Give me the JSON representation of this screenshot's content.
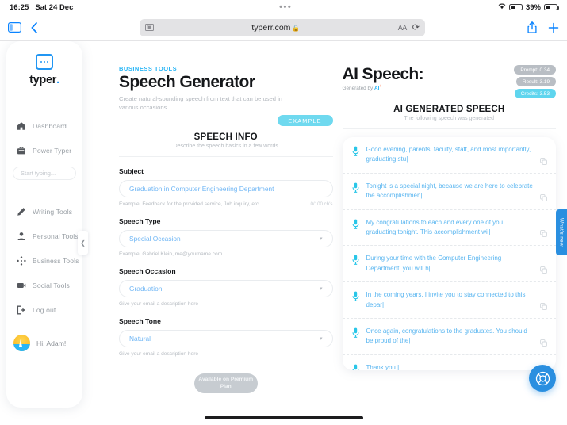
{
  "statusbar": {
    "time": "16:25",
    "date": "Sat 24 Dec",
    "center_dots": "•••",
    "wifi_icon": "wifi-icon",
    "battery_percent": "39%",
    "battery_level": 39
  },
  "browser": {
    "sidebar_toggle_icon": "sidebar-toggle-icon",
    "back_icon": "chevron-left-icon",
    "shield_icon": "content-blocker-icon",
    "url": "typerr.com",
    "lock_icon": "lock-icon",
    "text_size_label": "AA",
    "reload_icon": "reload-icon",
    "share_icon": "share-icon",
    "new_tab_icon": "plus-icon"
  },
  "sidebar": {
    "logo_text": "typer",
    "logo_dot": ".",
    "search_placeholder": "Start typing...",
    "items": [
      {
        "label": "Dashboard",
        "icon": "home-icon"
      },
      {
        "label": "Power Typer",
        "icon": "briefcase-icon"
      },
      {
        "label": "Writing Tools",
        "icon": "pencil-icon"
      },
      {
        "label": "Personal Tools",
        "icon": "person-icon"
      },
      {
        "label": "Business Tools",
        "icon": "network-icon"
      },
      {
        "label": "Social Tools",
        "icon": "video-icon"
      },
      {
        "label": "Log out",
        "icon": "logout-icon"
      }
    ],
    "user_greeting": "Hi, Adam!",
    "collapse_icon": "chevron-left-icon"
  },
  "left_panel": {
    "eyebrow": "BUSINESS TOOLS",
    "title": "Speech Generator",
    "subtitle": "Create natural-sounding speech from text that can be used in various occasions",
    "example_button": "EXAMPLE",
    "section_title": "SPEECH INFO",
    "section_sub": "Describe the speech basics in a few words",
    "fields": [
      {
        "label": "Subject",
        "value": "Graduation in Computer Engineering Department",
        "hint": "Example: Feedback for the provided service, Job inquiry, etc",
        "counter": "0/100 ch's",
        "type": "text"
      },
      {
        "label": "Speech Type",
        "value": "Special Occasion",
        "hint": "Example: Gabriel Klein, me@yourname.com",
        "counter": "",
        "type": "select"
      },
      {
        "label": "Speech Occasion",
        "value": "Graduation",
        "hint": "Give your email a description here",
        "counter": "",
        "type": "select"
      },
      {
        "label": "Speech Tone",
        "value": "Natural",
        "hint": "Give your email a description here",
        "counter": "",
        "type": "select"
      }
    ],
    "submit_button": "Available on Premium Plan"
  },
  "right_panel": {
    "title": "AI Speech:",
    "generated_by_prefix": "Generated by",
    "generated_by_ai": "AI",
    "generated_by_sup": "+",
    "badges": [
      {
        "label": "Prompt: 0.34",
        "kind": "grey"
      },
      {
        "label": "Result: 3.19",
        "kind": "grey"
      },
      {
        "label": "Credits: 3.53",
        "kind": "accent"
      }
    ],
    "section_title": "AI GENERATED SPEECH",
    "section_sub": "The following speech was generated",
    "mic_icon": "microphone-icon",
    "copy_icon": "copy-icon",
    "speech_lines": [
      "Good evening, parents, faculty, staff, and most importantly, graduating stu|",
      "Tonight is a special night, because we are here to celebrate the accomplishmen|",
      "My congratulations to each and every one of you graduating tonight. This accomplishment wil|",
      "During your time with the Computer Engineering Department, you will h|",
      "In the coming years, I invite you to stay connected to this depar|",
      "Once again, congratulations to the graduates. You should be proud of the|",
      "Thank you.|"
    ]
  },
  "overlays": {
    "whats_new": "What's new",
    "help_icon": "lifebuoy-icon"
  },
  "colors": {
    "accent_blue": "#29b6f6",
    "link_blue": "#58b5f0",
    "credits_teal": "#5fd5ee",
    "fab_blue": "#2a8fe0",
    "text_dark": "#15171a",
    "muted": "#b4b9bf"
  }
}
